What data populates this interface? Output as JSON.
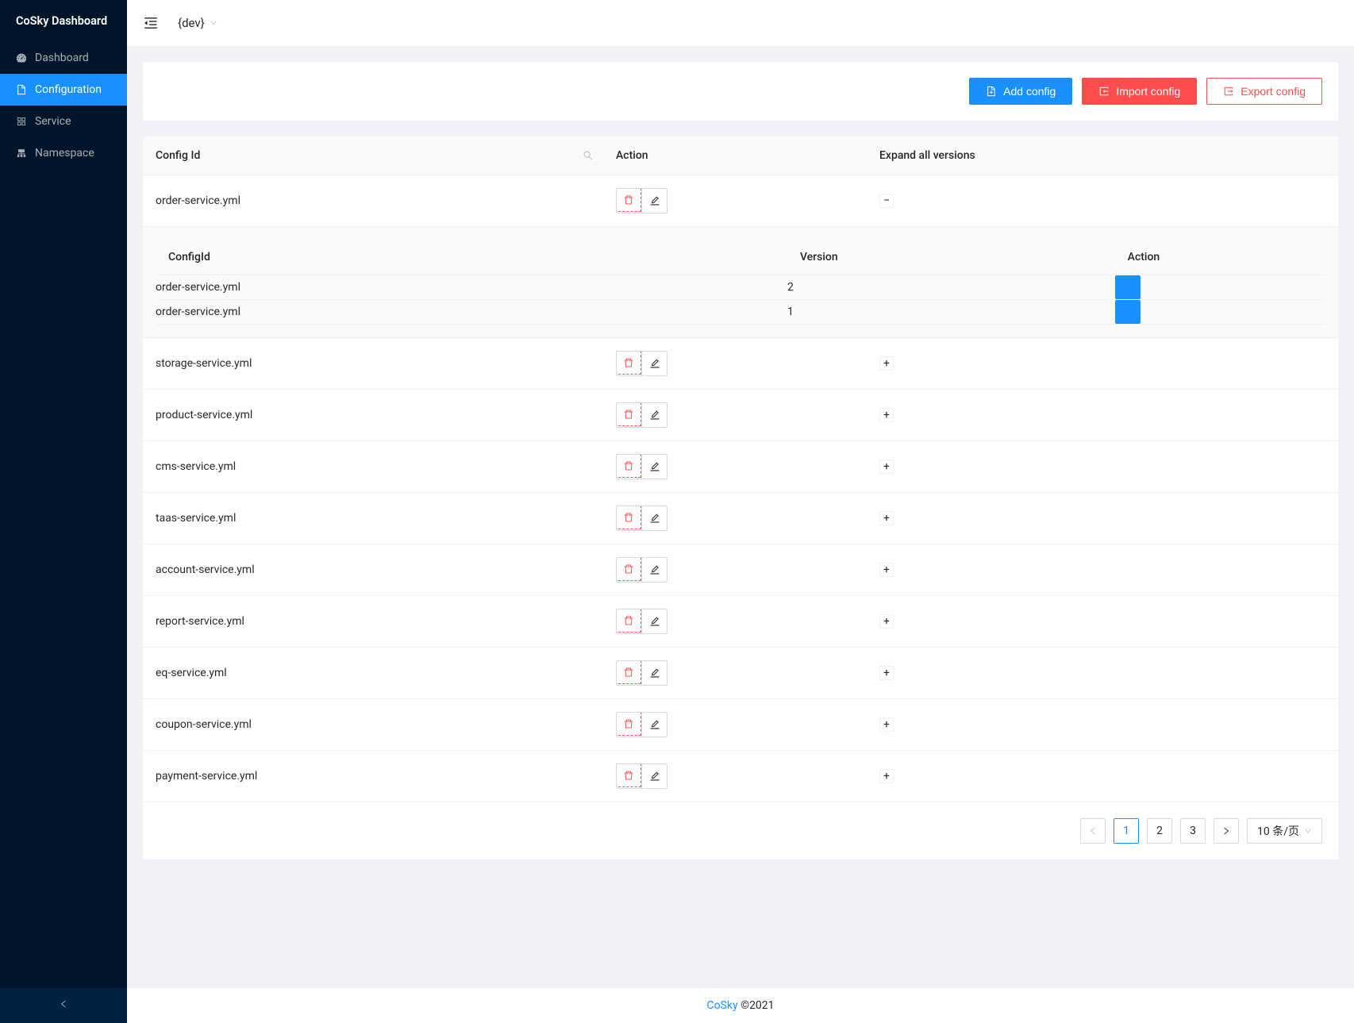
{
  "app_title": "CoSky Dashboard",
  "namespace": "{dev}",
  "sidebar": {
    "items": [
      {
        "label": "Dashboard",
        "icon": "dashboard"
      },
      {
        "label": "Configuration",
        "icon": "file"
      },
      {
        "label": "Service",
        "icon": "appstore"
      },
      {
        "label": "Namespace",
        "icon": "deployment"
      }
    ]
  },
  "toolbar": {
    "add_config": "Add config",
    "import_config": "Import config",
    "export_config": "Export config"
  },
  "table": {
    "headers": {
      "config_id": "Config Id",
      "action": "Action",
      "expand": "Expand all versions"
    },
    "rows": [
      {
        "config_id": "order-service.yml",
        "expanded": true
      },
      {
        "config_id": "storage-service.yml",
        "expanded": false
      },
      {
        "config_id": "product-service.yml",
        "expanded": false
      },
      {
        "config_id": "cms-service.yml",
        "expanded": false
      },
      {
        "config_id": "taas-service.yml",
        "expanded": false
      },
      {
        "config_id": "account-service.yml",
        "expanded": false
      },
      {
        "config_id": "report-service.yml",
        "expanded": false
      },
      {
        "config_id": "eq-service.yml",
        "expanded": false
      },
      {
        "config_id": "coupon-service.yml",
        "expanded": false
      },
      {
        "config_id": "payment-service.yml",
        "expanded": false
      }
    ]
  },
  "nested_table": {
    "headers": {
      "config_id": "ConfigId",
      "version": "Version",
      "action": "Action"
    },
    "rows": [
      {
        "config_id": "order-service.yml",
        "version": "2"
      },
      {
        "config_id": "order-service.yml",
        "version": "1"
      }
    ]
  },
  "pagination": {
    "pages": [
      "1",
      "2",
      "3"
    ],
    "current": "1",
    "page_size": "10 条/页"
  },
  "footer": {
    "link": "CoSky",
    "copyright": " ©2021"
  }
}
